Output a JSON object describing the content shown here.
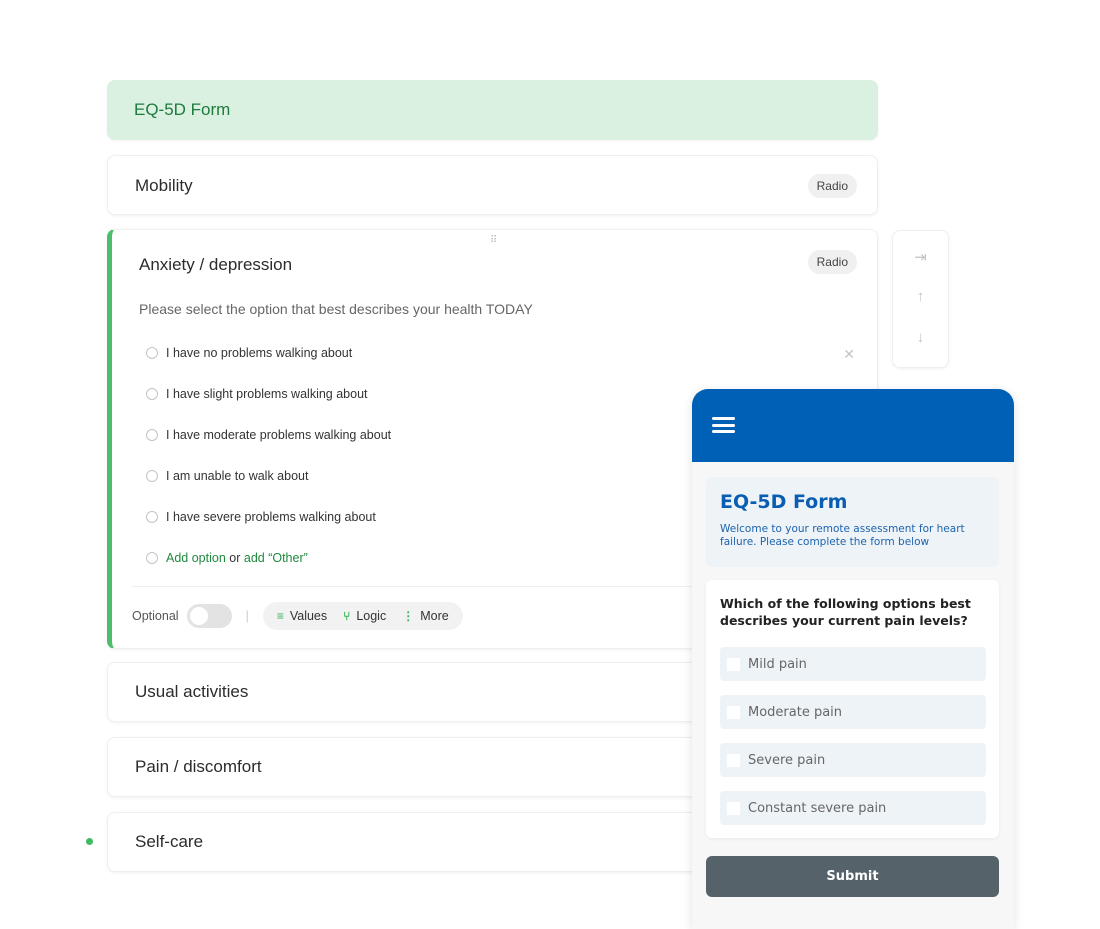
{
  "form": {
    "title": "EQ-5D Form",
    "sections": [
      {
        "title": "Mobility",
        "type": "Radio"
      },
      {
        "title": "Usual activities"
      },
      {
        "title": "Pain / discomfort"
      },
      {
        "title": "Self-care"
      }
    ],
    "active": {
      "title": "Anxiety / depression",
      "type": "Radio",
      "description": "Please select the option that best describes your health TODAY",
      "options": [
        "I have no problems walking about",
        "I have slight problems walking about",
        "I have moderate problems walking about",
        "I am unable to walk about",
        "I have severe problems walking about"
      ],
      "add_option": "Add option",
      "or_text": "or",
      "add_other": "add “Other”",
      "optional_label": "Optional",
      "optional_on": false,
      "actions": {
        "values": "Values",
        "logic": "Logic",
        "more": "More"
      }
    }
  },
  "phone": {
    "title": "EQ-5D Form",
    "intro": "Welcome to your remote assessment for heart failure. Please complete the form below",
    "question": "Which of the following options best describes your current pain levels?",
    "choices": [
      "Mild pain",
      "Moderate pain",
      "Severe pain",
      "Constant severe pain"
    ],
    "submit": "Submit"
  },
  "colors": {
    "accent_green": "#4cbd6a",
    "phone_blue": "#0060b6",
    "submit_gray": "#56626a"
  }
}
